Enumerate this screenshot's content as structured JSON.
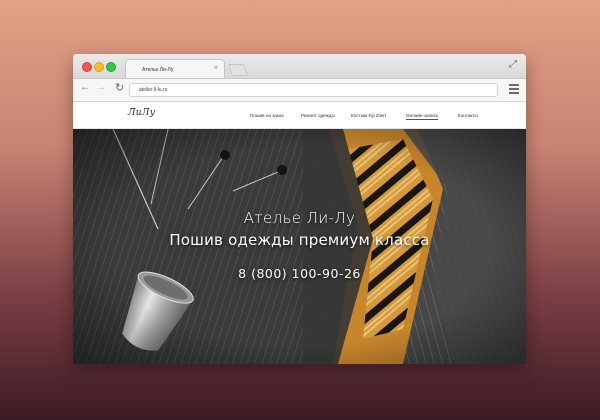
{
  "browser": {
    "tab_title": "Ателье Ли-Лу",
    "tab_close": "×",
    "url": "atelier.li-lu.ru",
    "expand_icon": "expand-icon",
    "back_icon": "arrow-left-icon",
    "forward_icon": "arrow-right-icon",
    "reload_icon": "reload-icon",
    "menu_icon": "hamburger-menu-icon",
    "traffic_colors": {
      "close": "#f5564e",
      "minimize": "#fbbc2e",
      "maximize": "#35c744"
    }
  },
  "site": {
    "logo": "ЛиЛу",
    "nav": [
      {
        "label": "Пошив на заказ",
        "active": false
      },
      {
        "label": "Ремонт одежды",
        "active": false
      },
      {
        "label": "Костюм Kiji Ziiert",
        "active": false
      },
      {
        "label": "Онлайн-запись",
        "active": true
      },
      {
        "label": "Контакты",
        "active": false
      }
    ],
    "hero": {
      "title": "Ателье Ли-Лу",
      "subtitle": "Пошив одежды премиум класса",
      "phone": "8 (800) 100-90-26"
    }
  },
  "colors": {
    "background_top": "#e2a184",
    "background_bottom": "#3d1b24",
    "tie_orange": "#d08f2c",
    "suit_dark": "#3b3b3b"
  }
}
